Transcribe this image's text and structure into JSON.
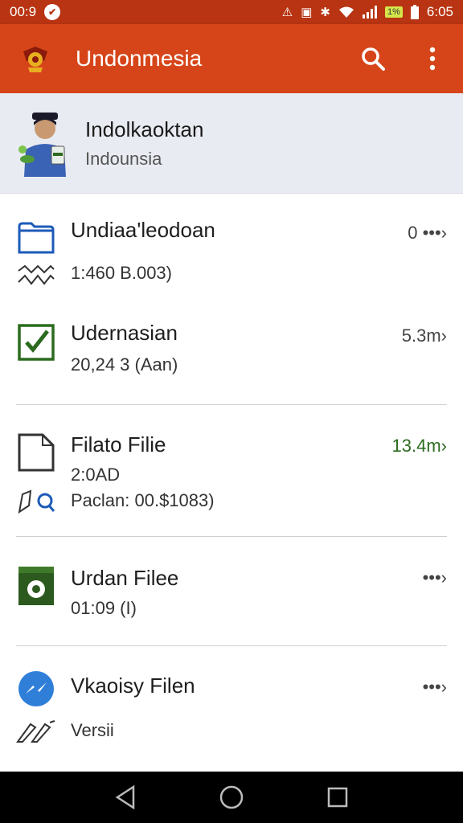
{
  "status_bar": {
    "time_left": "00:9",
    "time_right": "6:05",
    "battery_badge": "1%",
    "icons": [
      "notification-icon",
      "mute-icon",
      "image-icon",
      "bluetooth-icon",
      "wifi-icon",
      "signal-icon",
      "battery-icon"
    ]
  },
  "app_bar": {
    "title": "Undonmesia",
    "icons": [
      "logo-emblem-icon",
      "search-icon",
      "more-vert-icon"
    ]
  },
  "profile": {
    "name": "Indolkaoktan",
    "subtitle": "Indounsia"
  },
  "files": [
    {
      "title": "Undiaa'leodoan",
      "line1": "1:460 B.003)",
      "meta": "0 •••›",
      "icon": "folder-icon",
      "sub_icon": "wave-icon"
    },
    {
      "title": "Udernasian",
      "line1": "20,24 3 (Aan)",
      "meta": "5.3m›",
      "icon": "checkbox-icon"
    },
    {
      "title": "Filato Filie",
      "line1": "2:0AD",
      "line2": "Paclan: 00.$1083)",
      "meta": "13.4m›",
      "meta_color": "#2c6b1f",
      "icon": "document-icon",
      "sub_icon": "tag-search-icon"
    },
    {
      "title": "Urdan Filee",
      "line1": "01:09 (I)",
      "meta": "•••›",
      "icon": "green-file-icon"
    },
    {
      "title": "Vkaoisy Filen",
      "line1": "Versii",
      "meta": "•••›",
      "icon": "messenger-icon",
      "sub_icon": "pen-icon"
    }
  ],
  "nav_bar": {
    "icons": [
      "back-icon",
      "home-icon",
      "recents-icon"
    ]
  },
  "colors": {
    "status_bar": "#b83412",
    "app_bar": "#d64519",
    "profile_bg": "#e9ebf2",
    "accent_green": "#2c6b1f",
    "folder_blue": "#1d5bb8"
  }
}
